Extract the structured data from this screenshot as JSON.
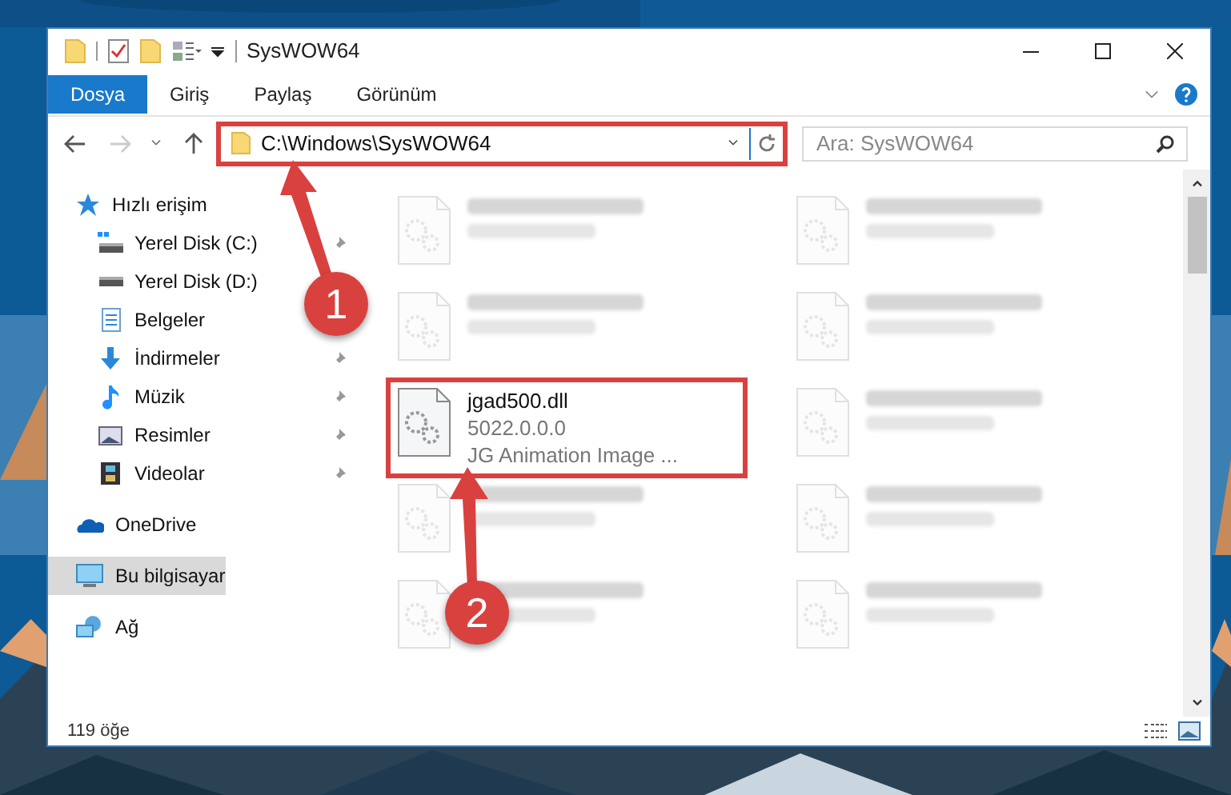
{
  "window": {
    "title": "SysWOW64"
  },
  "ribbon_tabs": [
    {
      "label": "Dosya",
      "selected": true
    },
    {
      "label": "Giriş",
      "selected": false
    },
    {
      "label": "Paylaş",
      "selected": false
    },
    {
      "label": "Görünüm",
      "selected": false
    }
  ],
  "address": {
    "path": "C:\\Windows\\SysWOW64",
    "highlighted": true
  },
  "search": {
    "placeholder": "Ara: SysWOW64"
  },
  "sidebar": {
    "items": [
      {
        "label": "Hızlı erişim",
        "kind": "star",
        "selected": false,
        "children": [
          {
            "label": "Yerel Disk (C:)",
            "kind": "drive-c",
            "pinned": true,
            "selected": false
          },
          {
            "label": "Yerel Disk (D:)",
            "kind": "drive",
            "pinned": false,
            "selected": false
          },
          {
            "label": "Belgeler",
            "kind": "documents",
            "pinned": false,
            "selected": false
          },
          {
            "label": "İndirmeler",
            "kind": "downloads",
            "pinned": true,
            "selected": false
          },
          {
            "label": "Müzik",
            "kind": "music",
            "pinned": true,
            "selected": false
          },
          {
            "label": "Resimler",
            "kind": "pictures",
            "pinned": true,
            "selected": false
          },
          {
            "label": "Videolar",
            "kind": "videos",
            "pinned": true,
            "selected": false
          }
        ]
      },
      {
        "label": "OneDrive",
        "kind": "cloud",
        "selected": false
      },
      {
        "label": "Bu bilgisayar",
        "kind": "computer",
        "selected": true
      },
      {
        "label": "Ağ",
        "kind": "network",
        "selected": false
      }
    ]
  },
  "files": [
    {
      "kind": "blurred"
    },
    {
      "kind": "blurred"
    },
    {
      "kind": "blurred"
    },
    {
      "kind": "blurred"
    },
    {
      "kind": "file",
      "name": "jgad500.dll",
      "lines": [
        "5022.0.0.0",
        "JG Animation Image ..."
      ],
      "highlighted": true
    },
    {
      "kind": "blurred"
    },
    {
      "kind": "blurred"
    },
    {
      "kind": "blurred"
    },
    {
      "kind": "blurred"
    },
    {
      "kind": "blurred"
    }
  ],
  "callouts": [
    {
      "label": "1"
    },
    {
      "label": "2"
    }
  ],
  "status_bar": {
    "count": "119 öğe"
  }
}
